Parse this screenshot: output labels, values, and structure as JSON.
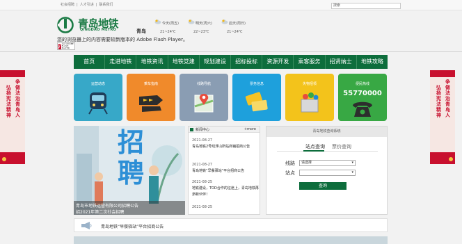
{
  "top": {
    "links": [
      "社会招聘",
      "|",
      "人才引进",
      "|",
      "联系我们"
    ],
    "search_placeholder": "搜索"
  },
  "header": {
    "logo_cn": "青岛地铁",
    "logo_en": "QINGDAO METRO",
    "city": "青岛",
    "weather": [
      {
        "day": "今天(周五)",
        "temp": "21~24℃"
      },
      {
        "day": "明天(周六)",
        "temp": "22~23℃"
      },
      {
        "day": "后天(周日)",
        "temp": "21~24℃"
      }
    ],
    "flash_text": "您的浏览器上的内容需要较新版本的 Adobe Flash Player。",
    "flash_badge": "Get ADOBE FLASH PLAYER"
  },
  "nav": [
    "首页",
    "走进地铁",
    "地铁资讯",
    "地铁党建",
    "规划建设",
    "招标投标",
    "资源开发",
    "乘客服务",
    "招贤纳士",
    "地铁攻略"
  ],
  "tiles": [
    {
      "label": "运营动态",
      "sub": ""
    },
    {
      "label": "乘车指南",
      "sub": ""
    },
    {
      "label": "线路导航",
      "sub": ""
    },
    {
      "label": "票务信息",
      "sub": ""
    },
    {
      "label": "失物招领",
      "sub": ""
    },
    {
      "label": "便民热线",
      "sub": "55770000"
    }
  ],
  "banner": {
    "big_text": "招聘",
    "caption_1": "青岛市地铁运营有限公司招聘公告",
    "caption_2": "招2021年第二次社会招聘"
  },
  "news": {
    "title": "新闻中心",
    "more": "+more",
    "items": [
      {
        "date": "2021-08-27",
        "title": "青岛地铁2号线浮山所站商铺招商公告"
      },
      {
        "date": "2021-08-27",
        "title": "青岛地铁“早餐驿站”平台招商公告"
      },
      {
        "date": "2021-08-25",
        "title": "地铁建设，TOD合作的征途上，青岛地铁再添新伙伴！"
      },
      {
        "date": "2021-08-25",
        "title": ""
      }
    ]
  },
  "query": {
    "title": "青岛地铁查询系统",
    "tab_active": "站点查询",
    "tab_inactive": "票价查询",
    "line_label": "线路",
    "line_value": "请选择",
    "station_label": "站点",
    "station_value": "",
    "button": "查询"
  },
  "notice": {
    "text": "青岛地铁“早餐驿站”平台招商公告"
  },
  "side_left": {
    "col1": "争做法治青岛人",
    "col2": "弘扬宪法精神"
  },
  "side_right": {
    "col1": "争做法治青岛人",
    "col2": "弘扬宪法精神"
  },
  "colors": {
    "brand_green": "#0d6d3c",
    "tile_blue": "#37a8c8",
    "tile_orange": "#f08a2b",
    "tile_slate": "#8a9db3",
    "tile_sky": "#1ea0dc",
    "tile_yellow": "#f3c31b",
    "tile_green": "#38a844"
  }
}
